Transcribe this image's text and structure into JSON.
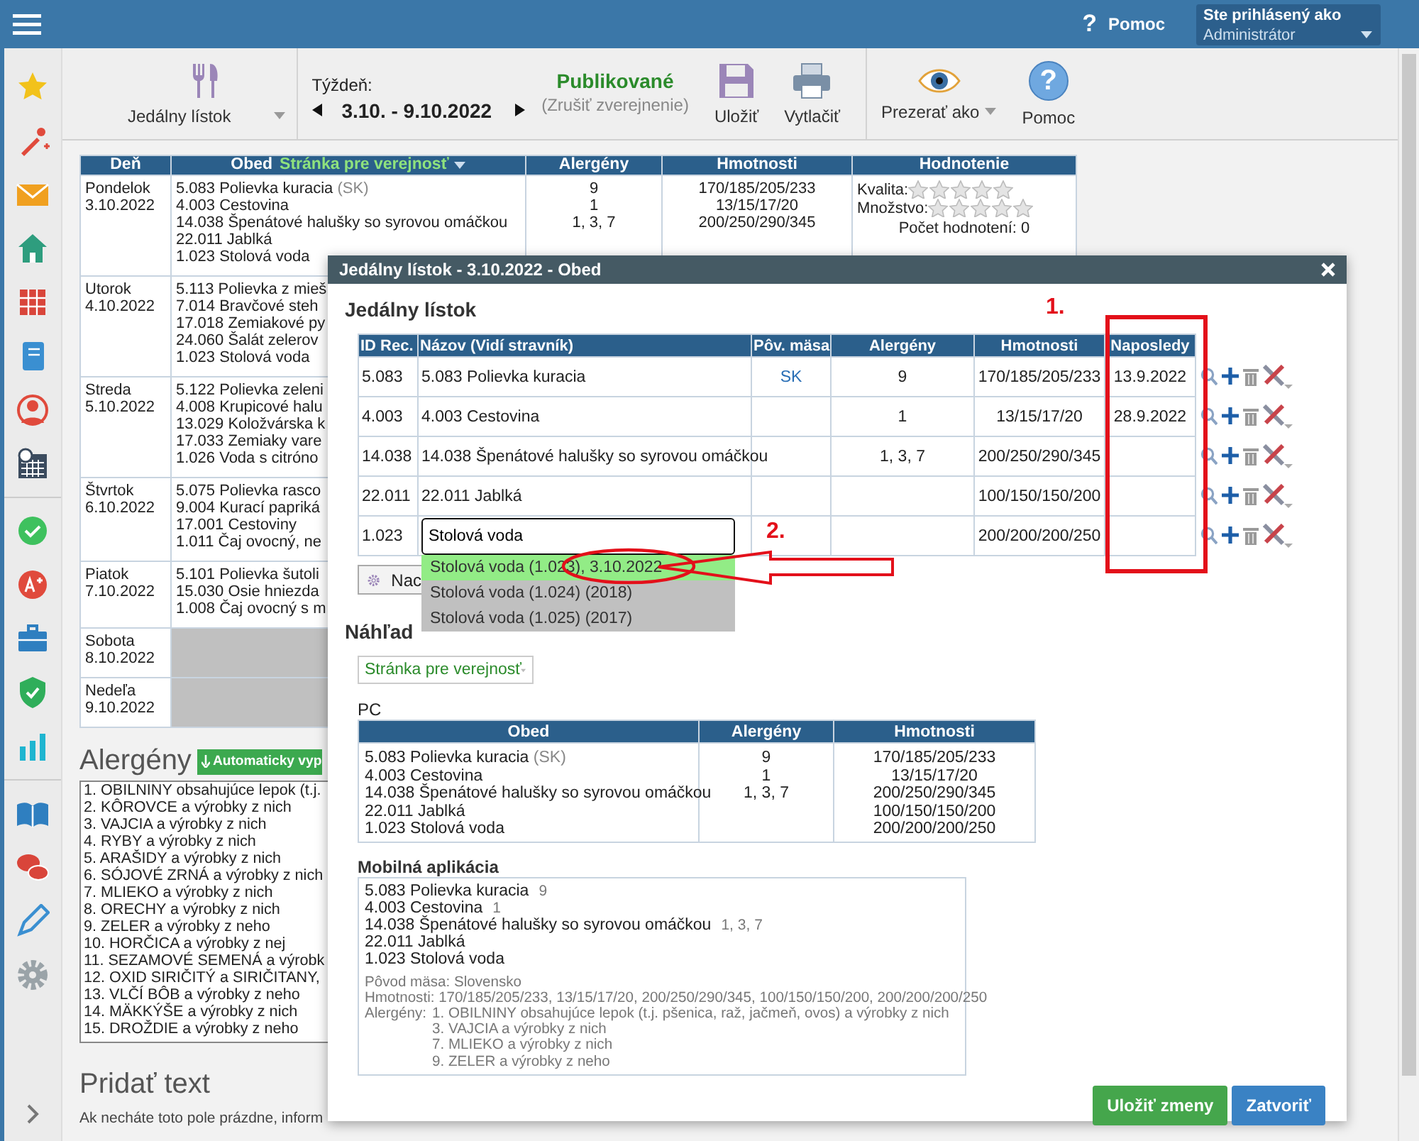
{
  "top_bar": {
    "help_glyph": "?",
    "help": "Pomoc",
    "user_label": "Ste prihlásený ako",
    "user_name": "Administrátor"
  },
  "toolbar": {
    "menu_select": "Jedálny lístok",
    "week_label": "Týždeň:",
    "week": "3.10. - 9.10.2022",
    "status": "Publikované",
    "status_action": "(Zrušiť zverejnenie)",
    "save": "Uložiť",
    "print": "Vytlačiť",
    "view_as": "Prezerať ako",
    "help_glyph": "?",
    "help": "Pomoc"
  },
  "week_table": {
    "columns": [
      "Deň",
      "Obed",
      "Alergény",
      "Hmotnosti",
      "Hodnotenie"
    ],
    "obed_filter": "Stránka pre verejnosť",
    "rows": [
      {
        "kind": "menu",
        "day": "Pondelok",
        "date": "3.10.2022",
        "dishes": [
          {
            "name": "5.083 Polievka kuracia",
            "origin": "(SK)"
          },
          {
            "name": "4.003 Cestovina"
          },
          {
            "name": "14.038 Špenátové halušky so syrovou omáčkou"
          },
          {
            "name": "22.011 Jablká"
          },
          {
            "name": "1.023 Stolová voda"
          }
        ],
        "allergens": [
          "9",
          "1",
          "1, 3, 7"
        ],
        "weights": [
          "170/185/205/233",
          "13/15/17/20",
          "200/250/290/345"
        ],
        "rating": {
          "quality": {
            "label": "Kvalita:",
            "stars": 0
          },
          "amount": {
            "label": "Množstvo:",
            "stars": 0
          },
          "count": "Počet hodnotení: 0"
        }
      },
      {
        "kind": "menu",
        "day": "Utorok",
        "date": "4.10.2022",
        "dishes": [
          {
            "name": "5.113 Polievka z mieš"
          },
          {
            "name": "7.014 Bravčové steh"
          },
          {
            "name": "17.018 Zemiakové py"
          },
          {
            "name": "24.060 Šalát zelerov"
          },
          {
            "name": "1.023 Stolová voda"
          }
        ]
      },
      {
        "kind": "menu",
        "day": "Streda",
        "date": "5.10.2022",
        "dishes": [
          {
            "name": "5.122 Polievka zeleni"
          },
          {
            "name": "4.008 Krupicové halu"
          },
          {
            "name": "13.029 Koložvárska k"
          },
          {
            "name": "17.033 Zemiaky vare"
          },
          {
            "name": "1.026 Voda s citróno"
          }
        ]
      },
      {
        "kind": "menu",
        "day": "Štvrtok",
        "date": "6.10.2022",
        "dishes": [
          {
            "name": "5.075 Polievka rasco"
          },
          {
            "name": "9.004 Kurací papriká"
          },
          {
            "name": "17.001 Cestoviny"
          },
          {
            "name": "1.011 Čaj ovocný, ne"
          }
        ]
      },
      {
        "kind": "menu",
        "day": "Piatok",
        "date": "7.10.2022",
        "dishes": [
          {
            "name": "5.101 Polievka šutoli"
          },
          {
            "name": "15.030 Osie hniezda"
          },
          {
            "name": "1.008 Čaj ovocný s m"
          }
        ]
      },
      {
        "kind": "empty",
        "day": "Sobota",
        "date": "8.10.2022"
      },
      {
        "kind": "empty",
        "day": "Nedeľa",
        "date": "9.10.2022"
      }
    ]
  },
  "allergens": {
    "title": "Alergény",
    "auto_fill": "Automaticky vyp",
    "items": [
      "1. OBILNINY obsahujúce lepok (t.j.",
      "2. KÔROVCE a výrobky z nich",
      "3. VAJCIA a výrobky z nich",
      "4. RYBY a výrobky z nich",
      "5. ARAŠIDY a výrobky z nich",
      "6. SÓJOVÉ ZRNÁ a výrobky z nich",
      "7. MLIEKO a výrobky z nich",
      "8. ORECHY a výrobky z nich",
      "9. ZELER a výrobky z neho",
      "10. HORČICA a výrobky z nej",
      "11. SEZAMOVÉ SEMENÁ a výrobk",
      "12. OXID SIRIČITÝ a SIRIČITANY,",
      "13. VLČÍ BÔB a výrobky z neho",
      "14. MÄKKÝŠE a výrobky z nich",
      "15. DROŽDIE a výrobky z neho"
    ]
  },
  "add_text": {
    "title": "Pridať text",
    "hint": "Ak necháte toto pole prázdne, inform"
  },
  "dialog": {
    "title": "Jedálny lístok - 3.10.2022 - Obed",
    "section": "Jedálny lístok",
    "columns": [
      "ID Rec.",
      "Názov (Vidí stravník)",
      "Pôv. mäsa",
      "Alergény",
      "Hmotnosti",
      "Naposledy"
    ],
    "items": [
      {
        "id": "5.083",
        "name": "5.083 Polievka kuracia",
        "meat_origin": "SK",
        "allergens": "9",
        "weights": "170/185/205/233",
        "last_served": "13.9.2022",
        "editing": false
      },
      {
        "id": "4.003",
        "name": "4.003 Cestovina",
        "allergens": "1",
        "weights": "13/15/17/20",
        "last_served": "28.9.2022",
        "editing": false
      },
      {
        "id": "14.038",
        "name": "14.038 Špenátové halušky so syrovou omáčkou",
        "allergens": "1, 3, 7",
        "weights": "200/250/290/345",
        "editing": false
      },
      {
        "id": "22.011",
        "name": "22.011 Jablká",
        "weights": "100/150/150/200",
        "editing": false
      },
      {
        "id": "1.023",
        "name": "Stolová voda",
        "weights": "200/200/200/250",
        "editing": true
      }
    ],
    "suggest_button": "Nac",
    "suggestions": [
      {
        "text": "Stolová voda (1.023), 3.10.2022",
        "selected": true
      },
      {
        "text": "Stolová voda (1.024) (2018)",
        "selected": false
      },
      {
        "text": "Stolová voda (1.025) (2017)",
        "selected": false
      }
    ],
    "annotations": [
      {
        "kind": "column_box",
        "label": "1."
      },
      {
        "kind": "arrow",
        "label": "2."
      }
    ],
    "preview": {
      "title": "Náhľad",
      "view_select": "Stránka pre verejnosť",
      "pc_label": "PC",
      "pc_columns": [
        "Obed",
        "Alergény",
        "Hmotnosti"
      ],
      "pc_dishes": [
        {
          "name": "5.083 Polievka kuracia",
          "origin": "(SK)"
        },
        {
          "name": "4.003 Cestovina"
        },
        {
          "name": "14.038 Špenátové halušky so syrovou omáčkou"
        },
        {
          "name": "22.011 Jablká"
        },
        {
          "name": "1.023 Stolová voda"
        }
      ],
      "pc_allergens": [
        "9",
        "1",
        "1, 3, 7"
      ],
      "pc_weights": [
        "170/185/205/233",
        "13/15/17/20",
        "200/250/290/345",
        "100/150/150/200",
        "200/200/200/250"
      ],
      "mobile_label": "Mobilná aplikácia",
      "mobile_items": [
        {
          "name": "5.083 Polievka kuracia",
          "allergens": "9"
        },
        {
          "name": "4.003 Cestovina",
          "allergens": "1"
        },
        {
          "name": "14.038 Špenátové halušky so syrovou omáčkou",
          "allergens": "1, 3, 7"
        },
        {
          "name": "22.011 Jablká"
        },
        {
          "name": "1.023 Stolová voda"
        }
      ],
      "meat_origin": "Pôvod mäsa: Slovensko",
      "weights_line": "Hmotnosti: 170/185/205/233, 13/15/17/20, 200/250/290/345, 100/150/150/200, 200/200/200/250",
      "allergens_label": "Alergény:",
      "allergen_lines": [
        "1. OBILNINY obsahujúce lepok (t.j. pšenica, raž, jačmeň, ovos) a výrobky z nich",
        "3. VAJCIA a výrobky z nich",
        "7. MLIEKO a výrobky z nich",
        "9. ZELER a výrobky z neho"
      ]
    },
    "buttons": [
      {
        "kind": "primary",
        "label": "Uložiť zmeny"
      },
      {
        "kind": "secondary",
        "label": "Zatvoriť"
      }
    ]
  }
}
